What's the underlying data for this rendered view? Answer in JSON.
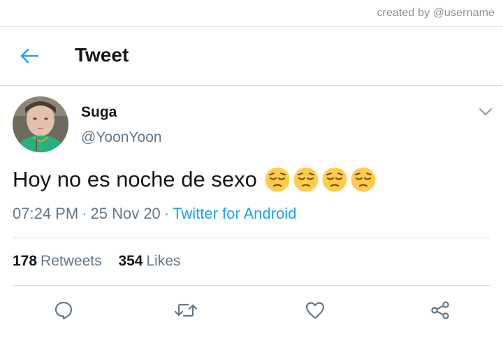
{
  "watermark": "created by @username",
  "header": {
    "title": "Tweet"
  },
  "tweet": {
    "author_name": "Suga",
    "author_handle": "@YoonYoon",
    "text": "Hoy no es noche de sexo",
    "emoji_count": 4,
    "time": "07:24 PM",
    "date": "25 Nov 20",
    "separator": "·",
    "source": "Twitter for Android",
    "retweets": "178",
    "retweets_label": "Retweets",
    "likes": "354",
    "likes_label": "Likes"
  },
  "icons": {
    "back": "arrow-left-icon",
    "more": "chevron-down-icon",
    "reply": "reply-icon",
    "retweet": "retweet-icon",
    "like": "heart-icon",
    "share": "share-icon",
    "emoji": "pensive-face-emoji"
  },
  "colors": {
    "accent": "#1da1f2",
    "text_primary": "#14171a",
    "text_secondary": "#657786",
    "divider": "#d8dce0"
  }
}
